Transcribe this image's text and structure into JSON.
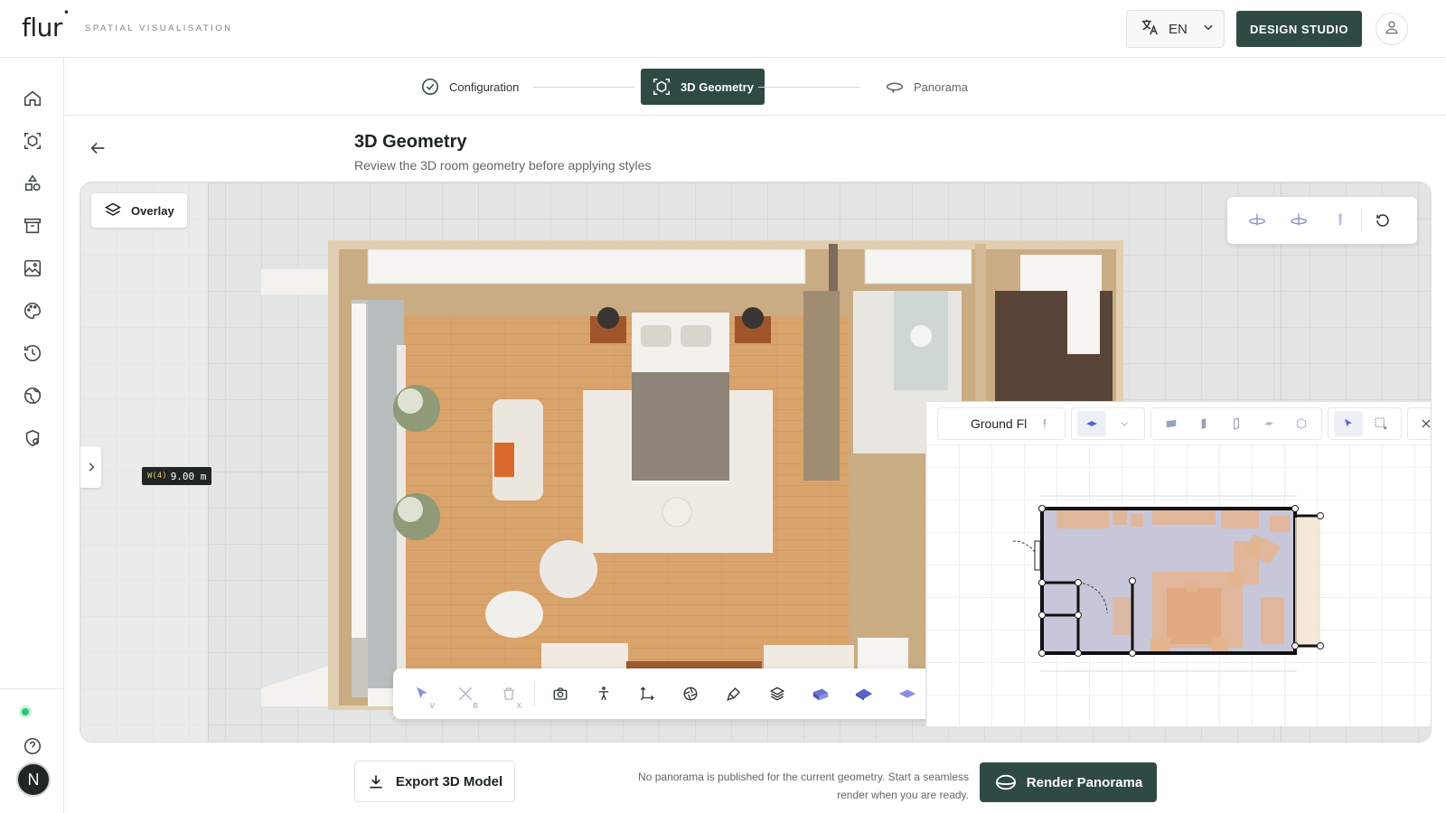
{
  "brand": {
    "name": "flur",
    "tagline": "SPATIAL VISUALISATION"
  },
  "header": {
    "language": "EN",
    "studio_label": "DESIGN STUDIO",
    "icons": {
      "language": "translate-icon",
      "dropdown": "chevron-down-icon",
      "user": "user-icon"
    }
  },
  "sidebar": {
    "items": [
      {
        "name": "home",
        "icon": "home-icon"
      },
      {
        "name": "geometry",
        "icon": "cube-icon"
      },
      {
        "name": "shapes",
        "icon": "shapes-icon"
      },
      {
        "name": "archive",
        "icon": "archive-icon"
      },
      {
        "name": "gallery",
        "icon": "image-edit-icon"
      },
      {
        "name": "palette",
        "icon": "palette-icon"
      },
      {
        "name": "history",
        "icon": "history-icon"
      },
      {
        "name": "globe",
        "icon": "globe-icon"
      },
      {
        "name": "settings",
        "icon": "shield-settings-icon"
      }
    ],
    "avatar_initial": "N"
  },
  "stepper": {
    "steps": [
      {
        "label": "Configuration",
        "state": "done"
      },
      {
        "label": "3D Geometry",
        "state": "active"
      },
      {
        "label": "Panorama",
        "state": "upcoming"
      }
    ]
  },
  "page": {
    "title": "3D Geometry",
    "subtitle": "Review the 3D room geometry before applying styles"
  },
  "viewport": {
    "overlay_label": "Overlay",
    "measure": {
      "key": "W(4)",
      "value": "9.00 m"
    },
    "bottom_tools": [
      {
        "icon": "select-arrow-icon",
        "key": "V"
      },
      {
        "icon": "wall-tool-icon",
        "key": "B"
      },
      {
        "icon": "trash-icon",
        "key": "X"
      },
      {
        "icon": "camera-icon",
        "key": ""
      },
      {
        "icon": "person-icon",
        "key": ""
      },
      {
        "icon": "axis-icon",
        "key": ""
      },
      {
        "icon": "aperture-icon",
        "key": ""
      },
      {
        "icon": "brush-icon",
        "key": ""
      },
      {
        "icon": "layers-icon",
        "key": ""
      },
      {
        "icon": "floor-view-1-icon",
        "key": ""
      },
      {
        "icon": "floor-view-2-icon",
        "key": ""
      },
      {
        "icon": "floor-view-3-icon",
        "key": ""
      }
    ],
    "view_tools": [
      "rotate-left-icon",
      "rotate-right-icon",
      "tilt-icon",
      "reset-icon"
    ]
  },
  "plan": {
    "title": "Ground Floor",
    "tools": [
      "pin-icon",
      "floor-icon",
      "chevron-down-icon",
      "door-icon",
      "wall-icon",
      "window-icon",
      "slab-icon",
      "object-icon",
      "select-icon",
      "marquee-icon",
      "close-icon"
    ]
  },
  "footer": {
    "export_label": "Export 3D Model",
    "notice_line1": "No panorama is published for the current geometry. Start a seamless",
    "notice_line2": "render when you are ready.",
    "render_label": "Render Panorama"
  },
  "colors": {
    "accent": "#2e4a43",
    "floor": "#d9a36c",
    "wall": "#e8d6bd"
  }
}
